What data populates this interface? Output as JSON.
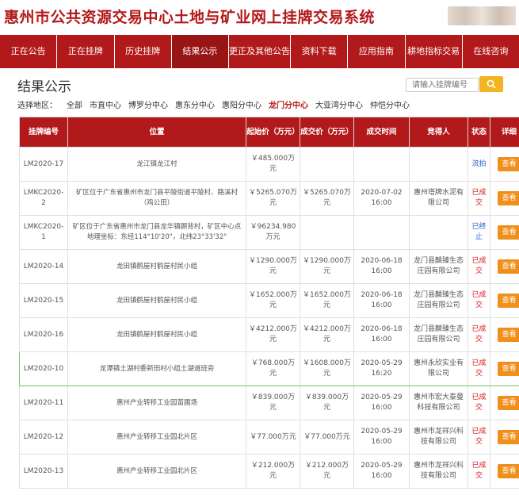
{
  "site": {
    "title": "惠州市公共资源交易中心土地与矿业网上挂牌交易系统"
  },
  "nav": [
    "正在公告",
    "正在挂牌",
    "历史挂牌",
    "结果公示",
    "更正及其他公告",
    "资料下载",
    "应用指南",
    "耕地指标交易",
    "在线咨询"
  ],
  "nav_active": "结果公示",
  "page": {
    "title": "结果公示",
    "search_placeholder": "请输入挂牌编号",
    "region_label": "选择地区：",
    "regions": [
      "全部",
      "市直中心",
      "博罗分中心",
      "惠东分中心",
      "惠阳分中心",
      "龙门分中心",
      "大亚湾分中心",
      "仲恺分中心"
    ],
    "selected_region": "龙门分中心"
  },
  "table": {
    "headers": [
      "挂牌编号",
      "位置",
      "起始价（万元）",
      "成交价（万元）",
      "成交时间",
      "竞得人",
      "状态",
      "详细"
    ],
    "view_label": "查看",
    "rows": [
      {
        "id": "LM2020-17",
        "location": "龙江镇龙江村",
        "start_price": "￥485.000万元",
        "deal_price": "",
        "deal_time": "",
        "winner": "",
        "status": "流拍"
      },
      {
        "id": "LMKC2020-2",
        "location": "矿区位于广东省惠州市龙门县平陵街道平陵村、路溪村（鸡公田）",
        "start_price": "￥5265.070万元",
        "deal_price": "￥5265.070万元",
        "deal_time": "2020-07-02 16:00",
        "winner": "惠州塔牌水泥有限公司",
        "status": "已成交"
      },
      {
        "id": "LMKC2020-1",
        "location": "矿区位于广东省惠州市龙门县龙华镇朗背村，矿区中心点地理坐标：东经114°10'20\"，北纬23°33'32\"",
        "start_price": "￥96234.980万元",
        "deal_price": "",
        "deal_time": "",
        "winner": "",
        "status": "已终止"
      },
      {
        "id": "LM2020-14",
        "location": "龙田镇鹤屋村鹤屋村民小组",
        "start_price": "￥1290.000万元",
        "deal_price": "￥1290.000万元",
        "deal_time": "2020-06-18 16:00",
        "winner": "龙门县麟臻生态庄园有限公司",
        "status": "已成交"
      },
      {
        "id": "LM2020-15",
        "location": "龙田镇鹤屋村鹤屋村民小组",
        "start_price": "￥1652.000万元",
        "deal_price": "￥1652.000万元",
        "deal_time": "2020-06-18 16:00",
        "winner": "龙门县麟臻生态庄园有限公司",
        "status": "已成交"
      },
      {
        "id": "LM2020-16",
        "location": "龙田镇鹤屋村鹤屋村民小组",
        "start_price": "￥4212.000万元",
        "deal_price": "￥4212.000万元",
        "deal_time": "2020-06-18 16:00",
        "winner": "龙门县麟臻生态庄园有限公司",
        "status": "已成交"
      },
      {
        "id": "LM2020-10",
        "location": "龙潭镇土湖村委新田村小组土湖道班旁",
        "start_price": "￥768.000万元",
        "deal_price": "￥1608.000万元",
        "deal_time": "2020-05-29 16:20",
        "winner": "惠州永欣实业有限公司",
        "status": "已成交"
      },
      {
        "id": "LM2020-11",
        "location": "惠州产业转移工业园苗圃场",
        "start_price": "￥839.000万元",
        "deal_price": "￥839.000万元",
        "deal_time": "2020-05-29 16:00",
        "winner": "惠州市宏大泰曼科技有限公司",
        "status": "已成交"
      },
      {
        "id": "LM2020-12",
        "location": "惠州产业转移工业园北片区",
        "start_price": "￥77.000万元",
        "deal_price": "￥77.000万元",
        "deal_time": "2020-05-29 16:00",
        "winner": "惠州市龙祥兴科技有限公司",
        "status": "已成交"
      },
      {
        "id": "LM2020-13",
        "location": "惠州产业转移工业园北片区",
        "start_price": "￥212.000万元",
        "deal_price": "￥212.000万元",
        "deal_time": "2020-05-29 16:00",
        "winner": "惠州市龙祥兴科技有限公司",
        "status": "已成交"
      }
    ]
  }
}
